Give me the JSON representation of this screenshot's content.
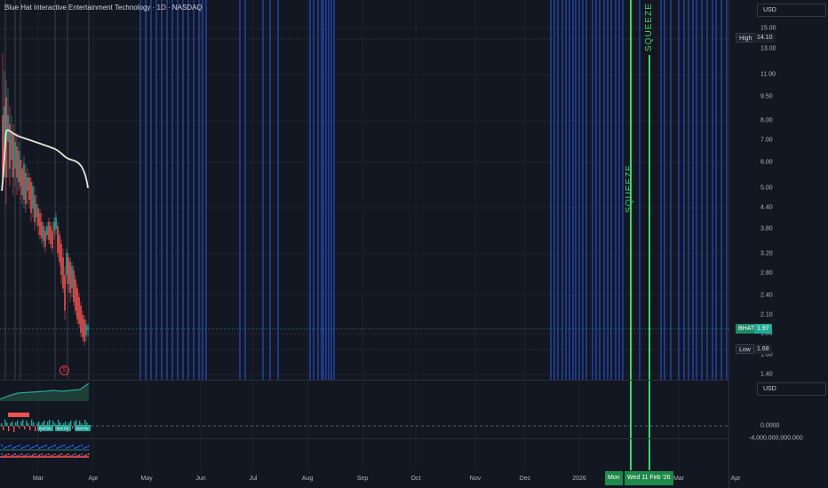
{
  "header": {
    "title": "Blue Hat Interactive Entertainment Technology · 1D · NASDAQ"
  },
  "price_axis": {
    "currency": "USD",
    "ticks": [
      "15.00",
      "13.00",
      "11.00",
      "9.50",
      "8.00",
      "7.00",
      "6.00",
      "5.00",
      "4.40",
      "3.80",
      "3.20",
      "2.80",
      "2.40",
      "2.10",
      "1.85",
      "1.60",
      "1.40"
    ],
    "high_label": "High",
    "high_value": "14.10",
    "low_label": "Low",
    "low_value": "1.68",
    "symbol_label": "BHAT",
    "symbol_value": "1.97"
  },
  "indicator_axis": {
    "currency": "USD",
    "zero_value": "0.0000",
    "neg_value": "-4,000,000,000.000"
  },
  "time_axis": {
    "months": [
      "Mar",
      "Apr",
      "May",
      "Jun",
      "Jul",
      "Aug",
      "Sep",
      "Oct",
      "Nov",
      "Dec",
      "2026",
      "Feb",
      "Mar",
      "Apr"
    ],
    "date_tag_1": "Mon",
    "date_tag_2": "Wed 11 Feb '26"
  },
  "annotations": {
    "squeeze_1": "SQUEEZE",
    "squeeze_2": "SQUEEZE",
    "dividend_marker": "S",
    "badge_a": "Bull Div",
    "badge_b": "Bull Div",
    "badge_c": "Bull Div"
  },
  "colors": {
    "background": "#131722",
    "up": "#26a69a",
    "down": "#ef5350",
    "blue_lines": "#2962ff",
    "squeeze_green": "#3ed66b",
    "ma_line": "#e8e4d8"
  }
}
